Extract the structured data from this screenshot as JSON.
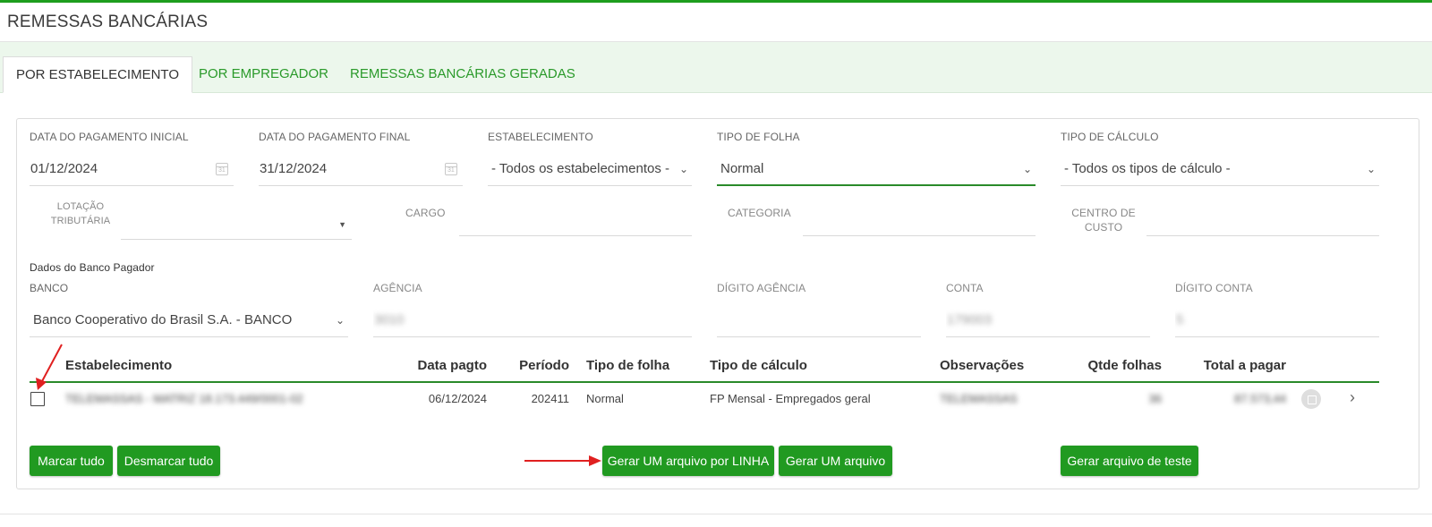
{
  "page": {
    "title": "REMESSAS BANCÁRIAS"
  },
  "tabs": [
    {
      "label": "POR ESTABELECIMENTO",
      "active": true
    },
    {
      "label": "POR EMPREGADOR",
      "active": false
    },
    {
      "label": "REMESSAS BANCÁRIAS GERADAS",
      "active": false
    }
  ],
  "filters": {
    "data_inicial": {
      "label": "DATA DO PAGAMENTO INICIAL",
      "value": "01/12/2024"
    },
    "data_final": {
      "label": "DATA DO PAGAMENTO FINAL",
      "value": "31/12/2024"
    },
    "estabelecimento": {
      "label": "ESTABELECIMENTO",
      "value": "- Todos os estabelecimentos -"
    },
    "tipo_folha": {
      "label": "TIPO DE FOLHA",
      "value": "Normal"
    },
    "tipo_calculo": {
      "label": "TIPO DE CÁLCULO",
      "value": "- Todos os tipos de cálculo -"
    },
    "lotacao": {
      "label_line1": "LOTAÇÃO",
      "label_line2": "TRIBUTÁRIA",
      "value": ""
    },
    "cargo": {
      "label": "CARGO",
      "value": ""
    },
    "categoria": {
      "label": "CATEGORIA",
      "value": ""
    },
    "centro_custo": {
      "label_line1": "CENTRO DE",
      "label_line2": "CUSTO",
      "value": ""
    }
  },
  "banco_pagador": {
    "section_title": "Dados do Banco Pagador",
    "banco": {
      "label": "BANCO",
      "value": "Banco Cooperativo do Brasil S.A. - BANCO"
    },
    "agencia": {
      "label": "AGÊNCIA",
      "value": "3010"
    },
    "digito_agencia": {
      "label": "DÍGITO AGÊNCIA",
      "value": ""
    },
    "conta": {
      "label": "CONTA",
      "value": "179003"
    },
    "digito_conta": {
      "label": "DÍGITO CONTA",
      "value": "5"
    }
  },
  "table": {
    "columns": {
      "estabelecimento": "Estabelecimento",
      "data_pagto": "Data pagto",
      "periodo": "Período",
      "tipo_folha": "Tipo de folha",
      "tipo_calculo": "Tipo de cálculo",
      "observacoes": "Observações",
      "qtde_folhas": "Qtde folhas",
      "total_pagar": "Total a pagar"
    },
    "rows": [
      {
        "checked": false,
        "estabelecimento": "TELEMASSAS - MATRIZ 18.173.449/0001-02",
        "data_pagto": "06/12/2024",
        "periodo": "202411",
        "tipo_folha": "Normal",
        "tipo_calculo": "FP Mensal - Empregados geral",
        "observacoes": "TELEMASSAS",
        "qtde_folhas": "36",
        "total_pagar": "87.573,44"
      }
    ]
  },
  "buttons": {
    "marcar_tudo": "Marcar tudo",
    "desmarcar_tudo": "Desmarcar tudo",
    "gerar_por_linha": "Gerar UM arquivo por LINHA",
    "gerar_um": "Gerar UM arquivo",
    "gerar_teste": "Gerar arquivo de teste"
  },
  "icons": {
    "calendar": "calendar-icon",
    "dropdown": "chevron-down-icon",
    "save": "save-icon",
    "row_expand": "chevron-right-icon",
    "annotation": "red-arrow"
  },
  "colors": {
    "accent": "#219a21",
    "tab_bar": "#ecf7ec",
    "annotation": "#e02020"
  }
}
